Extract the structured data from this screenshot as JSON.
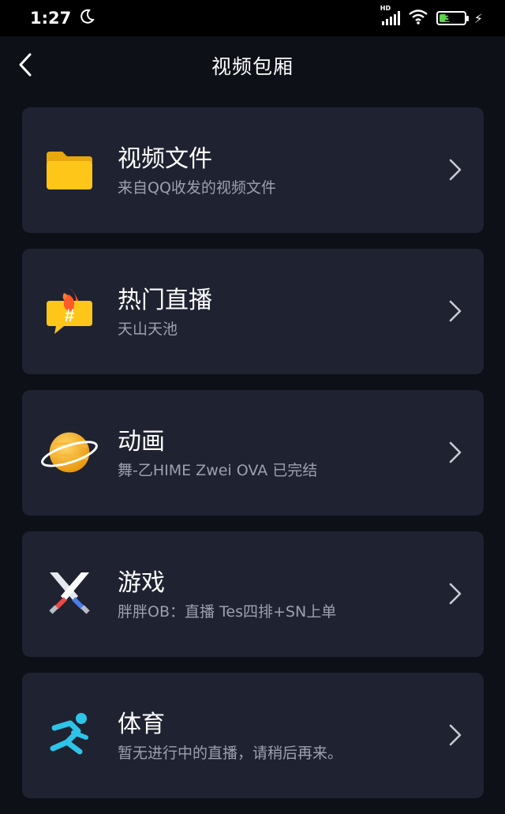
{
  "status_bar": {
    "time": "1:27",
    "network_label": "HD",
    "battery_level": "33"
  },
  "header": {
    "title": "视频包厢"
  },
  "items": [
    {
      "title": "视频文件",
      "subtitle": "来自QQ收发的视频文件",
      "icon": "folder-icon"
    },
    {
      "title": "热门直播",
      "subtitle": "天山天池",
      "icon": "hot-live-icon"
    },
    {
      "title": "动画",
      "subtitle": "舞-乙HIME Zwei OVA 已完结",
      "icon": "planet-icon"
    },
    {
      "title": "游戏",
      "subtitle": "胖胖OB：直播 Tes四排+SN上单",
      "icon": "crossed-swords-icon"
    },
    {
      "title": "体育",
      "subtitle": "暂无进行中的直播，请稍后再来。",
      "icon": "runner-icon"
    }
  ],
  "colors": {
    "background": "#0e1018",
    "card": "#1f2230",
    "subtitle": "#9da0ae",
    "accent_folder": "#ffc61a",
    "accent_sport": "#2ec4e8"
  }
}
